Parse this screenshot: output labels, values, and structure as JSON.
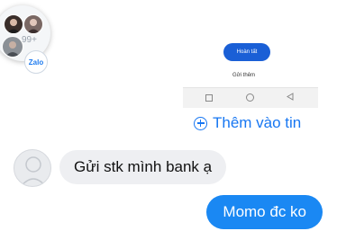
{
  "chat_head": {
    "count": "99+",
    "app_badge": "Zalo"
  },
  "story_preview": {
    "done_button": "Hoàn tất",
    "send_more": "Gửi thêm"
  },
  "add_to_story": {
    "label": "Thêm vào tin",
    "icon": "plus-circle-icon",
    "color": "#1877f2"
  },
  "messages": [
    {
      "direction": "incoming",
      "text": "Gửi stk mình bank ạ"
    },
    {
      "direction": "outgoing",
      "text": "Momo đc ko",
      "color": "#1a88f3"
    }
  ]
}
